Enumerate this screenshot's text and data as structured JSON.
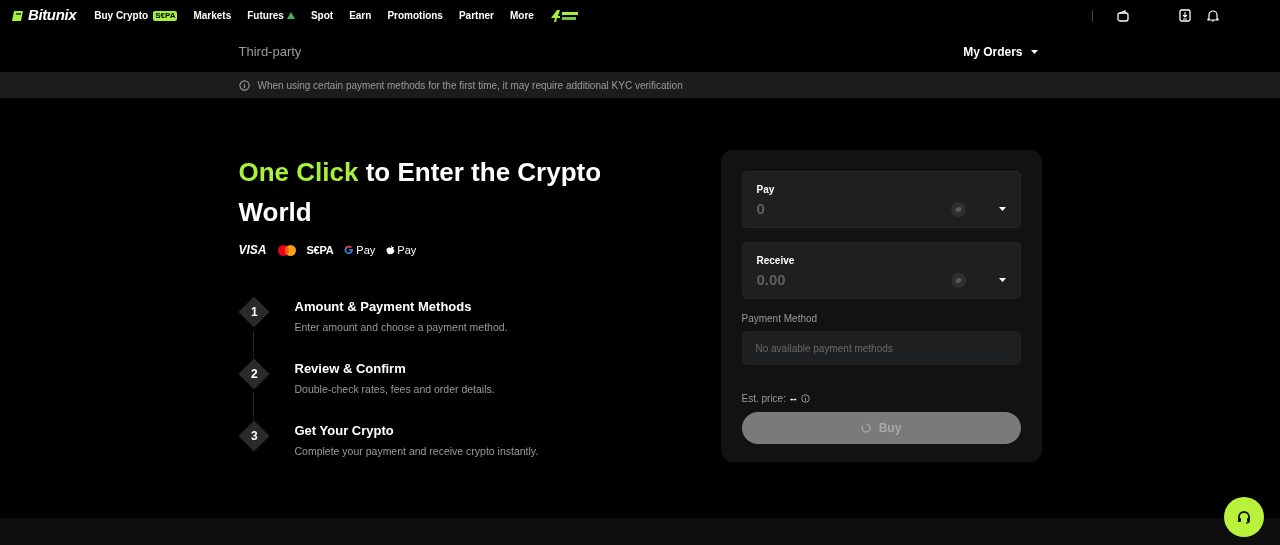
{
  "nav": {
    "logo": "Bitunix",
    "items": [
      {
        "label": "Buy Crypto",
        "badge": "S€PA"
      },
      {
        "label": "Markets"
      },
      {
        "label": "Futures",
        "kind": "hot"
      },
      {
        "label": "Spot"
      },
      {
        "label": "Earn"
      },
      {
        "label": "Promotions"
      },
      {
        "label": "Partner"
      },
      {
        "label": "More"
      }
    ]
  },
  "subheader": {
    "title": "Third-party",
    "orders": "My Orders"
  },
  "notice": "When using certain payment methods for the first time, it may require additional KYC verification",
  "hero": {
    "highlight": "One Click",
    "title": " to Enter the Crypto World",
    "payment_logos": [
      {
        "kind": "visa",
        "text": "VISA"
      },
      {
        "kind": "mastercard"
      },
      {
        "kind": "sepa",
        "text": "S€PA"
      },
      {
        "kind": "gpay",
        "text": "Pay"
      },
      {
        "kind": "applepay",
        "text": "Pay"
      }
    ],
    "steps": [
      {
        "number": "1",
        "title": "Amount & Payment Methods",
        "description": "Enter amount and choose a payment method."
      },
      {
        "number": "2",
        "title": "Review & Confirm",
        "description": "Double-check rates, fees and order details."
      },
      {
        "number": "3",
        "title": "Get Your Crypto",
        "description": "Complete your payment and receive crypto instantly."
      }
    ]
  },
  "form": {
    "pay": {
      "label": "Pay",
      "placeholder": "0"
    },
    "receive": {
      "label": "Receive",
      "placeholder": "0.00"
    },
    "payment_method": {
      "label": "Payment Method",
      "placeholder": "No available payment methods"
    },
    "est_price": {
      "label": "Est. price:",
      "value": "--"
    },
    "buy": {
      "label": "Buy",
      "disabled": true,
      "loading": true
    }
  }
}
